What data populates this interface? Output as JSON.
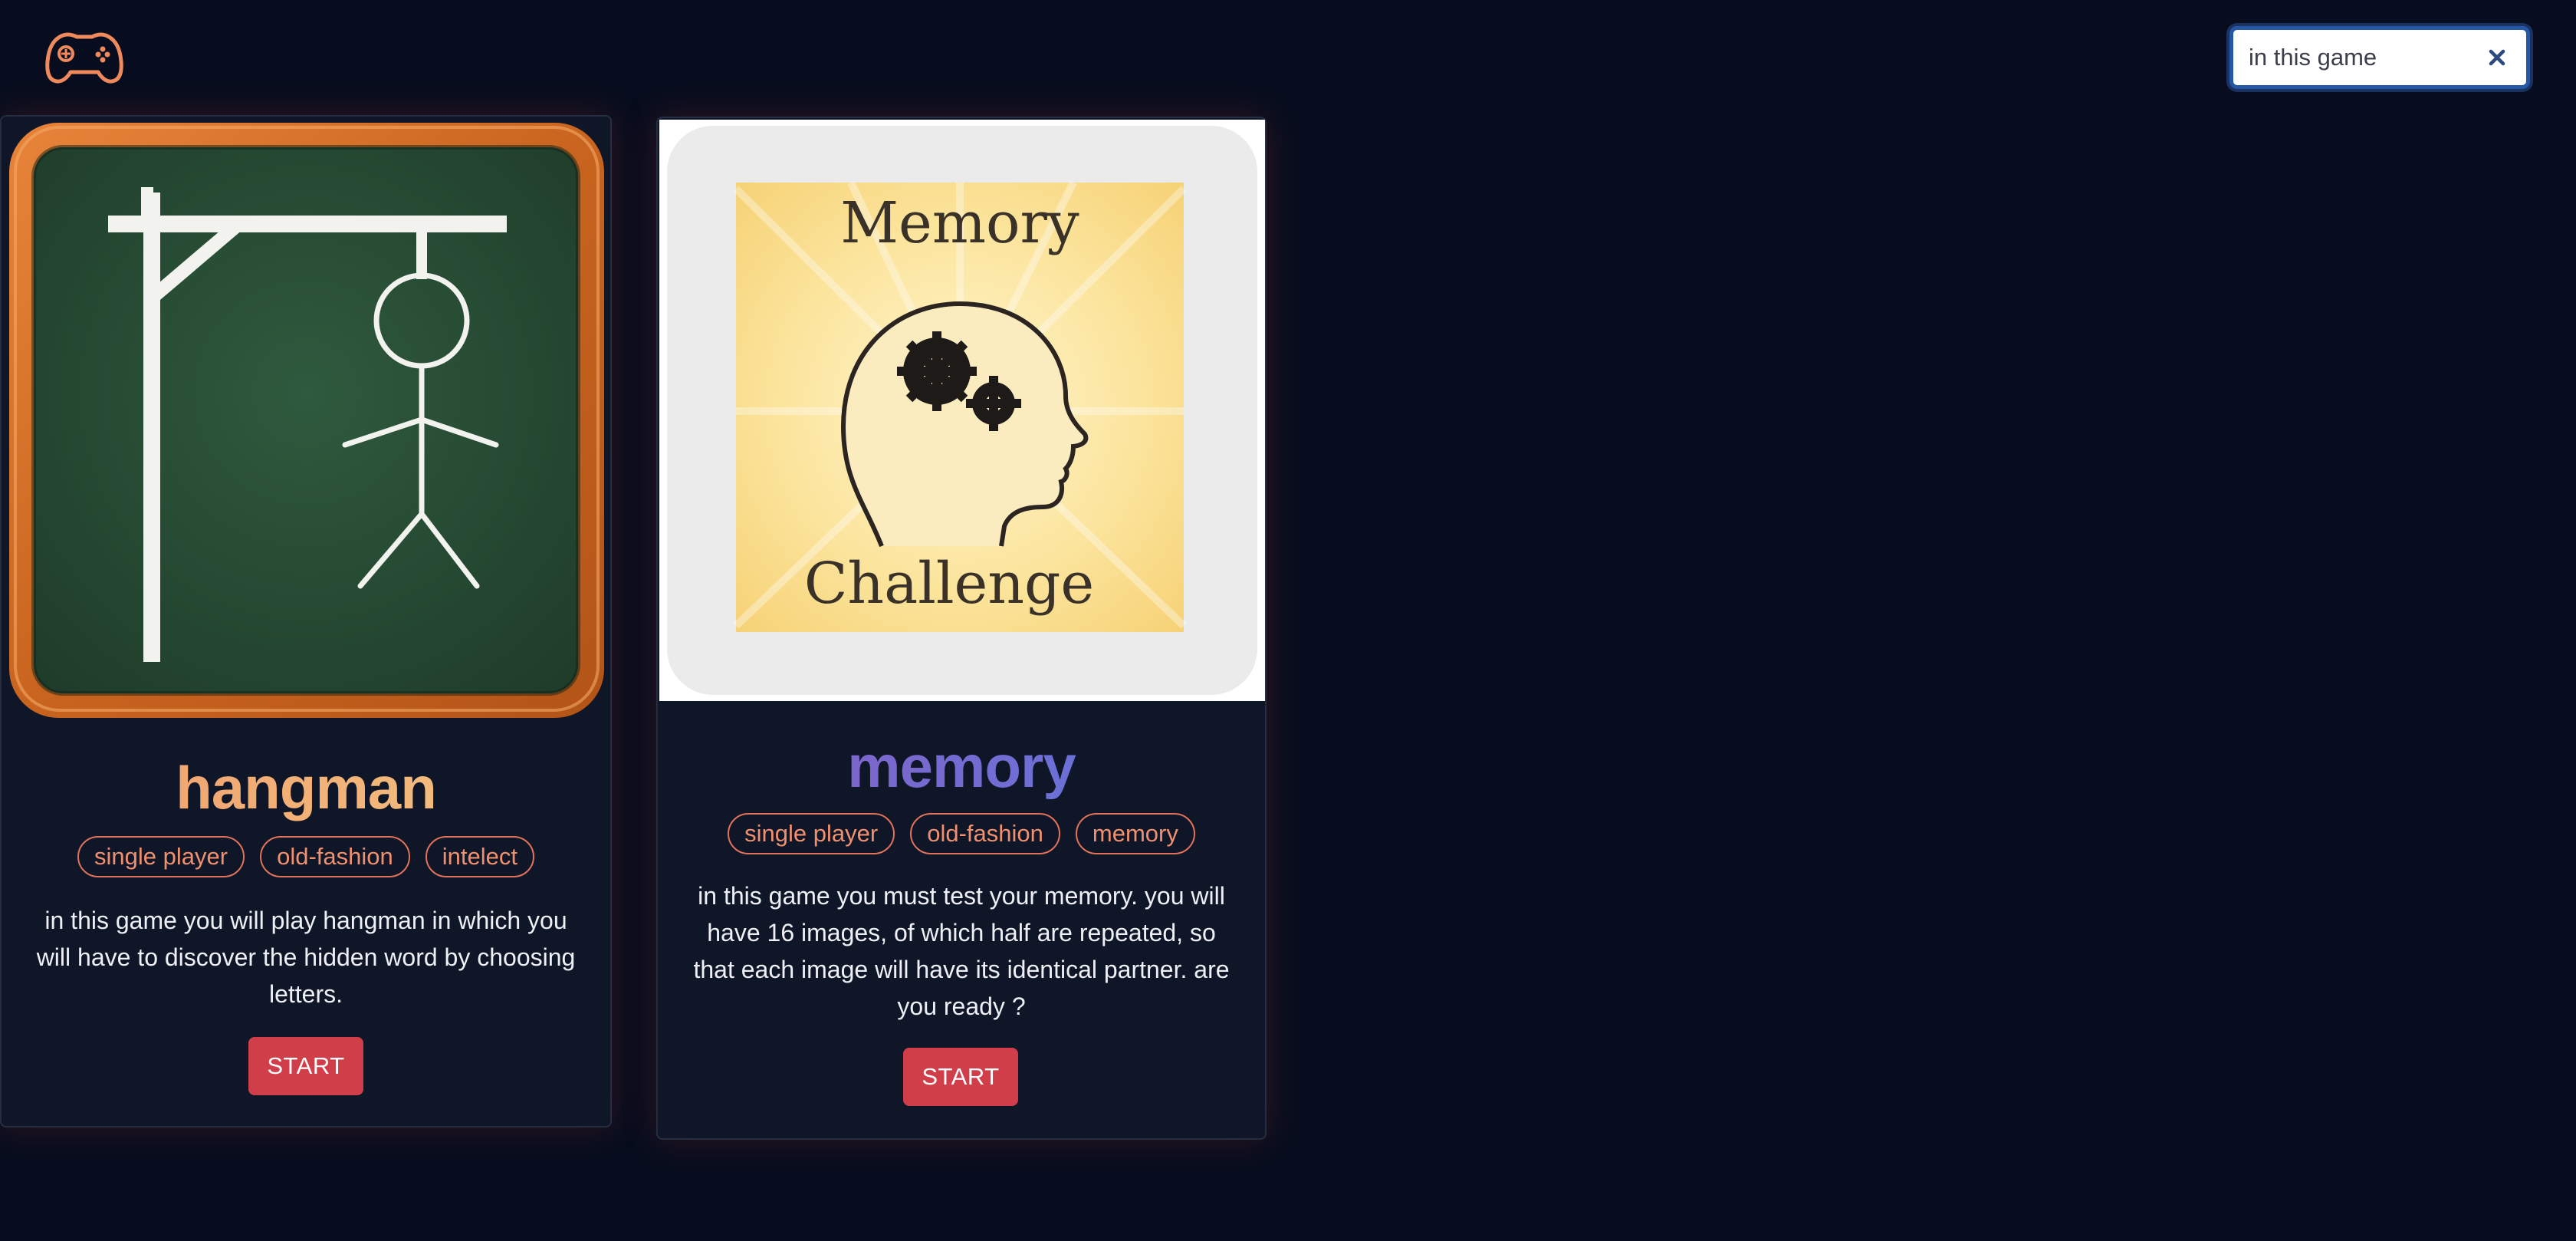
{
  "header": {
    "logo_icon": "gamepad-icon",
    "accent_color": "#f08a5d"
  },
  "search": {
    "value": "in this game",
    "clear_icon": "close-icon"
  },
  "cards": [
    {
      "title": "hangman",
      "image_icon": "hangman-chalkboard-image",
      "tags": [
        "single player",
        "old-fashion",
        "intelect"
      ],
      "description": "in this game you will play hangman in which you will have to discover the hidden word by choosing letters.",
      "button_label": "START"
    },
    {
      "title": "memory",
      "image_icon": "memory-challenge-image",
      "image_text_top": "Memory",
      "image_text_bottom": "Challenge",
      "tags": [
        "single player",
        "old-fashion",
        "memory"
      ],
      "description": "in this game you must test your memory. you will have 16 images, of which half are repeated, so that each image will have its identical partner. are you ready ?",
      "button_label": "START"
    }
  ],
  "colors": {
    "background": "#070d1e",
    "card_background": "#0f1628",
    "tag_border": "#e2735a",
    "button": "#d03f49"
  }
}
